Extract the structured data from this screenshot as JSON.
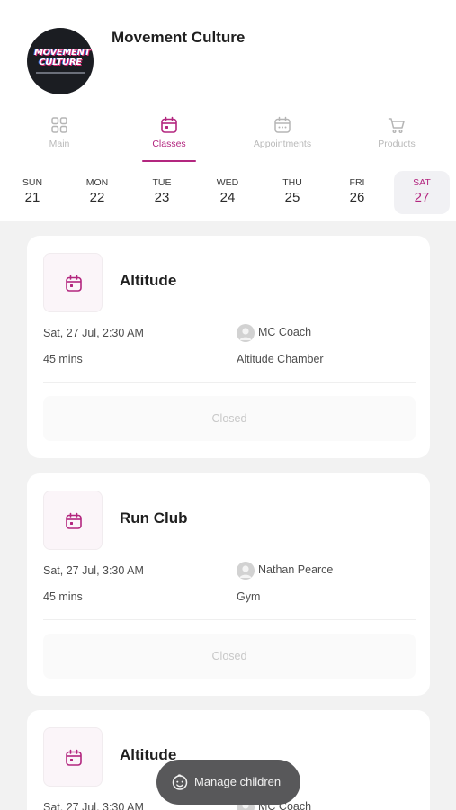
{
  "header": {
    "gym_name": "Movement Culture",
    "logo_text_line1": "MOVEMENT",
    "logo_text_line2": "CULTURE"
  },
  "tabs": [
    {
      "label": "Main",
      "icon": "grid-icon",
      "active": false
    },
    {
      "label": "Classes",
      "icon": "calendar-icon",
      "active": true
    },
    {
      "label": "Appointments",
      "icon": "calendar-dots-icon",
      "active": false
    },
    {
      "label": "Products",
      "icon": "cart-icon",
      "active": false
    }
  ],
  "days": [
    {
      "dow": "SUN",
      "num": "21"
    },
    {
      "dow": "MON",
      "num": "22"
    },
    {
      "dow": "TUE",
      "num": "23"
    },
    {
      "dow": "WED",
      "num": "24"
    },
    {
      "dow": "THU",
      "num": "25"
    },
    {
      "dow": "FRI",
      "num": "26"
    },
    {
      "dow": "SAT",
      "num": "27",
      "selected": true
    }
  ],
  "classes": [
    {
      "title": "Altitude",
      "datetime": "Sat, 27 Jul, 2:30 AM",
      "duration": "45 mins",
      "coach": "MC Coach",
      "location": "Altitude Chamber",
      "status": "Closed"
    },
    {
      "title": "Run Club",
      "datetime": "Sat, 27 Jul, 3:30 AM",
      "duration": "45 mins",
      "coach": "Nathan Pearce",
      "location": "Gym",
      "status": "Closed"
    },
    {
      "title": "Altitude",
      "datetime": "Sat, 27 Jul, 3:30 AM",
      "duration": "",
      "coach": "MC Coach",
      "location": "",
      "status": ""
    }
  ],
  "fab": {
    "label": "Manage children",
    "icon": "child-face-icon"
  },
  "colors": {
    "accent": "#b3267f",
    "background": "#f2f2f2",
    "card": "#ffffff",
    "fab": "#58585a"
  }
}
